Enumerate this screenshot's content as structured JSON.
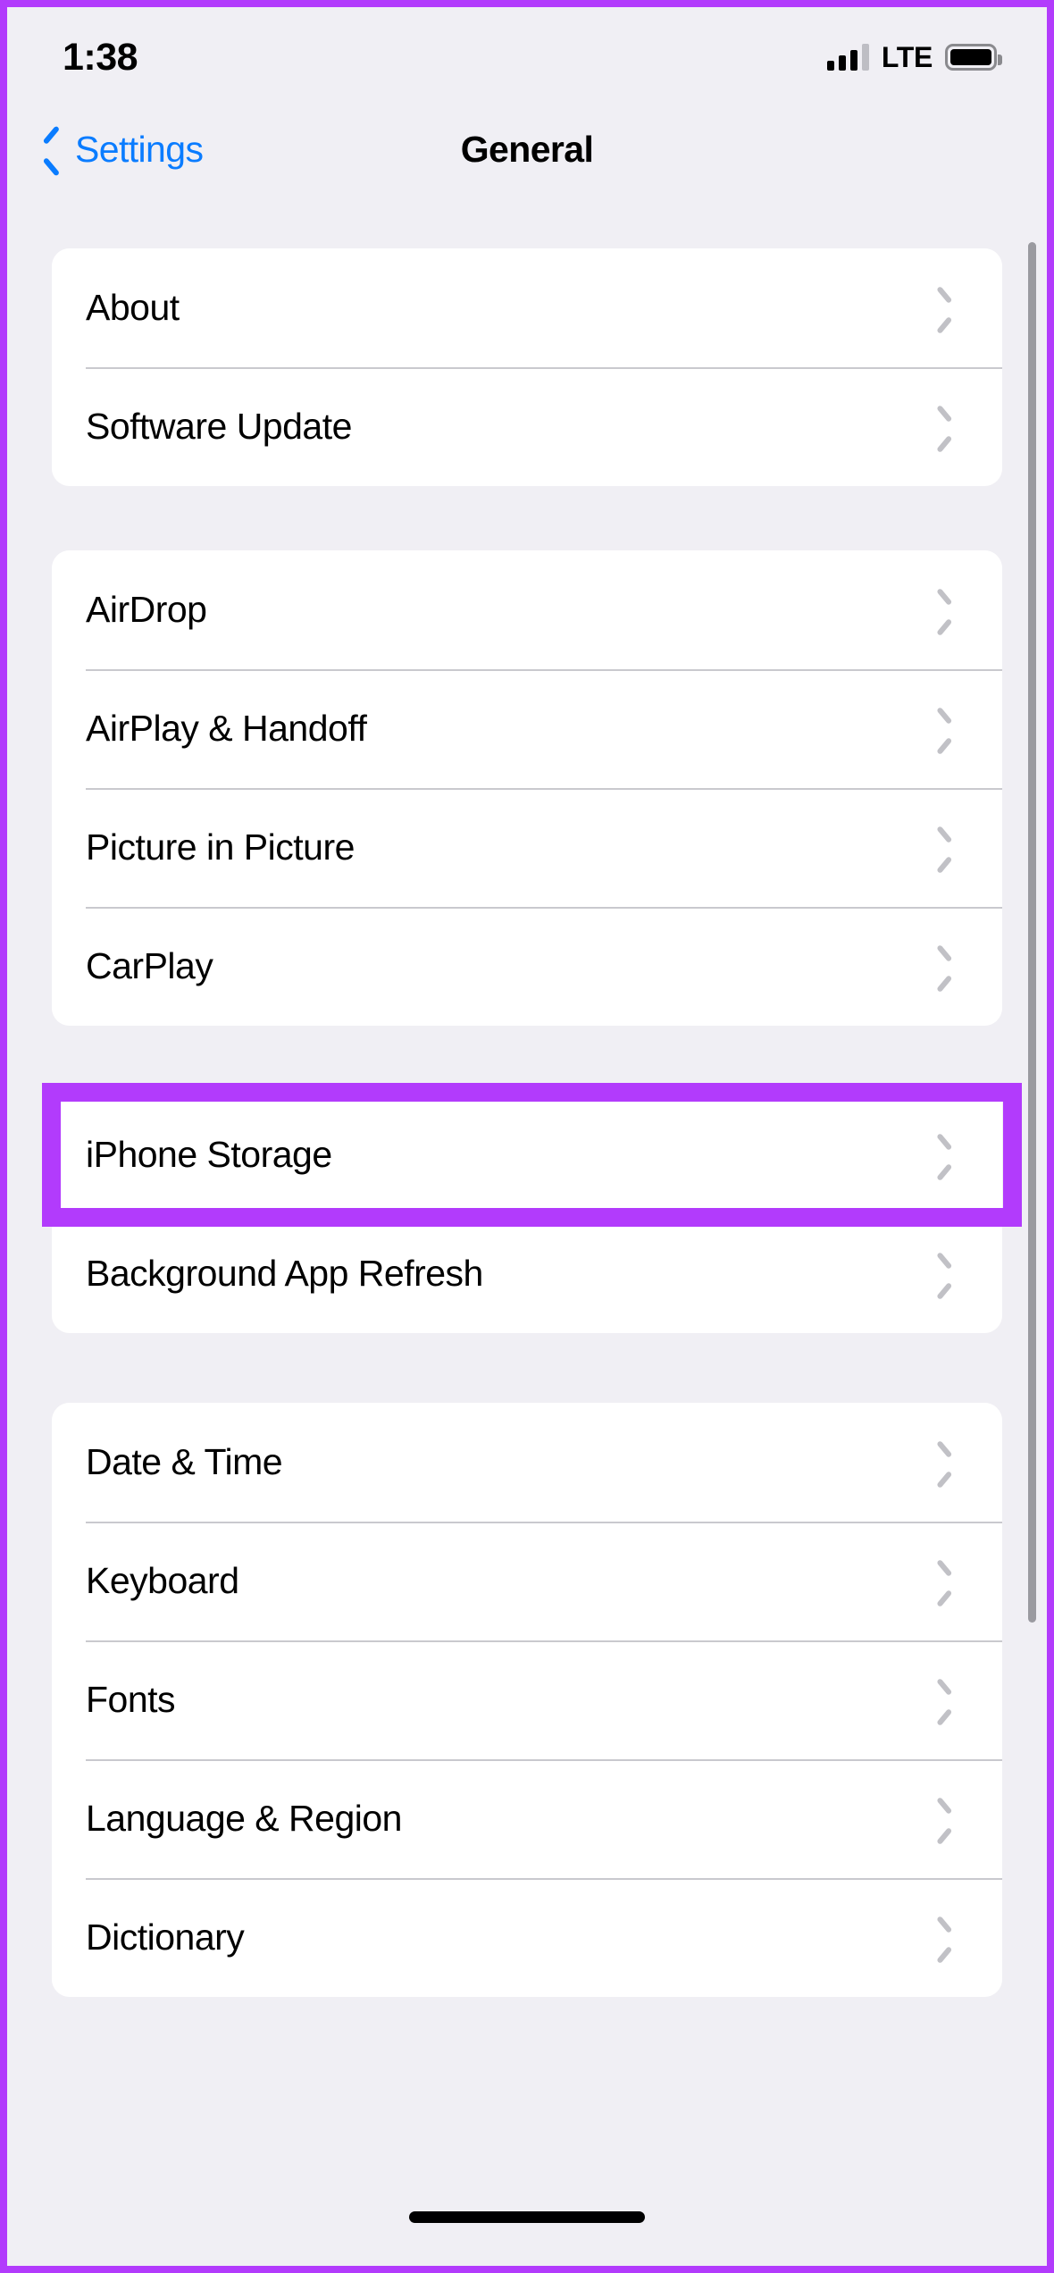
{
  "status_bar": {
    "time": "1:38",
    "network_label": "LTE",
    "signal_icon": "signal-bars-icon",
    "battery_icon": "battery-icon",
    "signal_bars_total": 4,
    "signal_bars_active": 3,
    "battery_level_percent": 100
  },
  "nav": {
    "back_label": "Settings",
    "back_icon": "chevron-left-icon",
    "title": "General"
  },
  "theme": {
    "background": "#F0EFF4",
    "card": "#FFFFFF",
    "accent_blue": "#0A7CFF",
    "highlight_purple": "#B23BFC",
    "separator": "#C9C9CE",
    "chevron_gray": "#C1C1C6"
  },
  "groups": [
    {
      "id": "group-device-info",
      "rows": [
        {
          "label": "About",
          "accessory": "chevron-right-icon"
        },
        {
          "label": "Software Update",
          "accessory": "chevron-right-icon"
        }
      ]
    },
    {
      "id": "group-connectivity",
      "rows": [
        {
          "label": "AirDrop",
          "accessory": "chevron-right-icon"
        },
        {
          "label": "AirPlay & Handoff",
          "accessory": "chevron-right-icon"
        },
        {
          "label": "Picture in Picture",
          "accessory": "chevron-right-icon"
        },
        {
          "label": "CarPlay",
          "accessory": "chevron-right-icon"
        }
      ]
    },
    {
      "id": "group-storage",
      "highlighted_row_index": 0,
      "rows": [
        {
          "label": "iPhone Storage",
          "accessory": "chevron-right-icon"
        },
        {
          "label": "Background App Refresh",
          "accessory": "chevron-right-icon"
        }
      ]
    },
    {
      "id": "group-localization",
      "rows": [
        {
          "label": "Date & Time",
          "accessory": "chevron-right-icon"
        },
        {
          "label": "Keyboard",
          "accessory": "chevron-right-icon"
        },
        {
          "label": "Fonts",
          "accessory": "chevron-right-icon"
        },
        {
          "label": "Language & Region",
          "accessory": "chevron-right-icon"
        },
        {
          "label": "Dictionary",
          "accessory": "chevron-right-icon"
        }
      ]
    }
  ],
  "home_indicator": "home-indicator-bar"
}
